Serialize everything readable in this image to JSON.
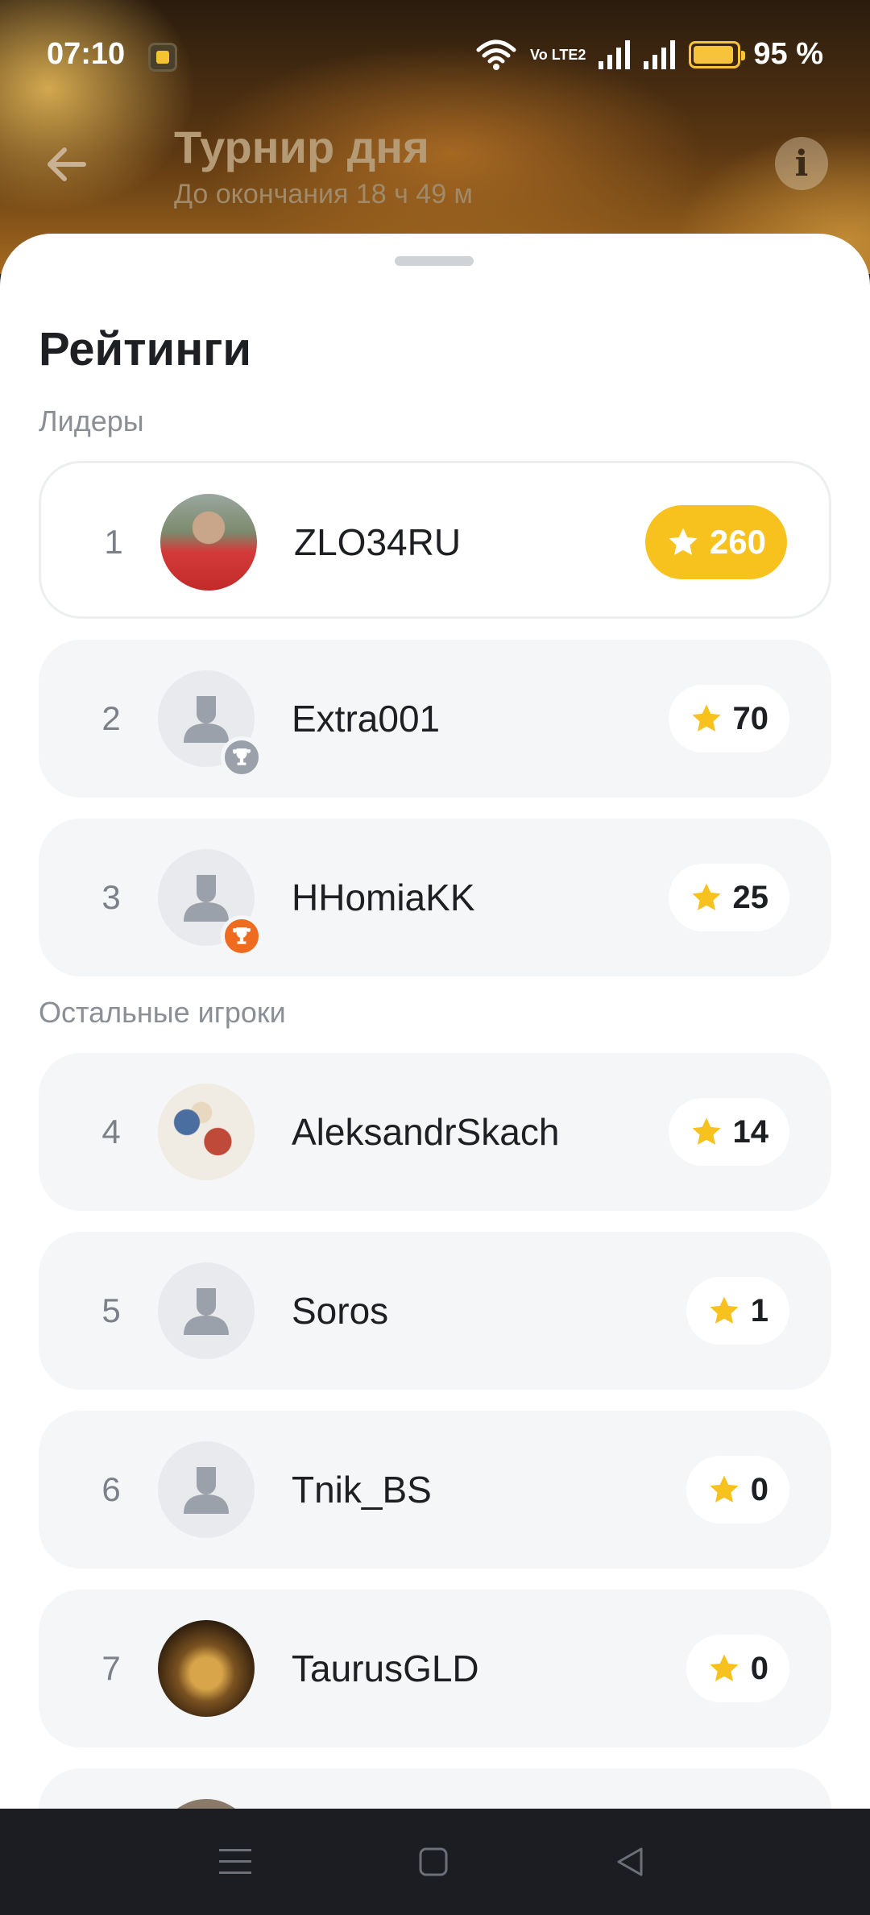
{
  "status_bar": {
    "time": "07:10",
    "battery": "95 %",
    "battery_level": 0.95,
    "volte": "Vo LTE2",
    "icons": [
      "app-notification-icon",
      "wifi-icon",
      "volte-icon",
      "signal-icon",
      "signal-icon",
      "battery-icon"
    ]
  },
  "header": {
    "title": "Турнир дня",
    "subtitle": "До окончания 18 ч 49 м",
    "back_icon": "back-arrow-icon",
    "info_icon": "i"
  },
  "sheet": {
    "title": "Рейтинги",
    "leaders_label": "Лидеры",
    "others_label": "Остальные игроки"
  },
  "leaders": [
    {
      "rank": "1",
      "name": "ZLO34RU",
      "score": "260",
      "avatar": "photo",
      "badge": ""
    },
    {
      "rank": "2",
      "name": "Extra001",
      "score": "70",
      "avatar": "placeholder",
      "badge": "silver-trophy"
    },
    {
      "rank": "3",
      "name": "HHomiaKK",
      "score": "25",
      "avatar": "placeholder",
      "badge": "bronze-trophy"
    }
  ],
  "others": [
    {
      "rank": "4",
      "name": "AleksandrSkach",
      "score": "14",
      "avatar": "photo"
    },
    {
      "rank": "5",
      "name": "Soros",
      "score": "1",
      "avatar": "placeholder"
    },
    {
      "rank": "6",
      "name": "Tnik_BS",
      "score": "0",
      "avatar": "placeholder"
    },
    {
      "rank": "7",
      "name": "TaurusGLD",
      "score": "0",
      "avatar": "photo"
    }
  ],
  "colors": {
    "gold": "#f8c21e",
    "silver": "#9aa1ab",
    "bronze": "#ef6b1f",
    "row_bg": "#f5f6f7"
  },
  "nav": [
    "menu-icon",
    "home-icon",
    "back-icon"
  ]
}
